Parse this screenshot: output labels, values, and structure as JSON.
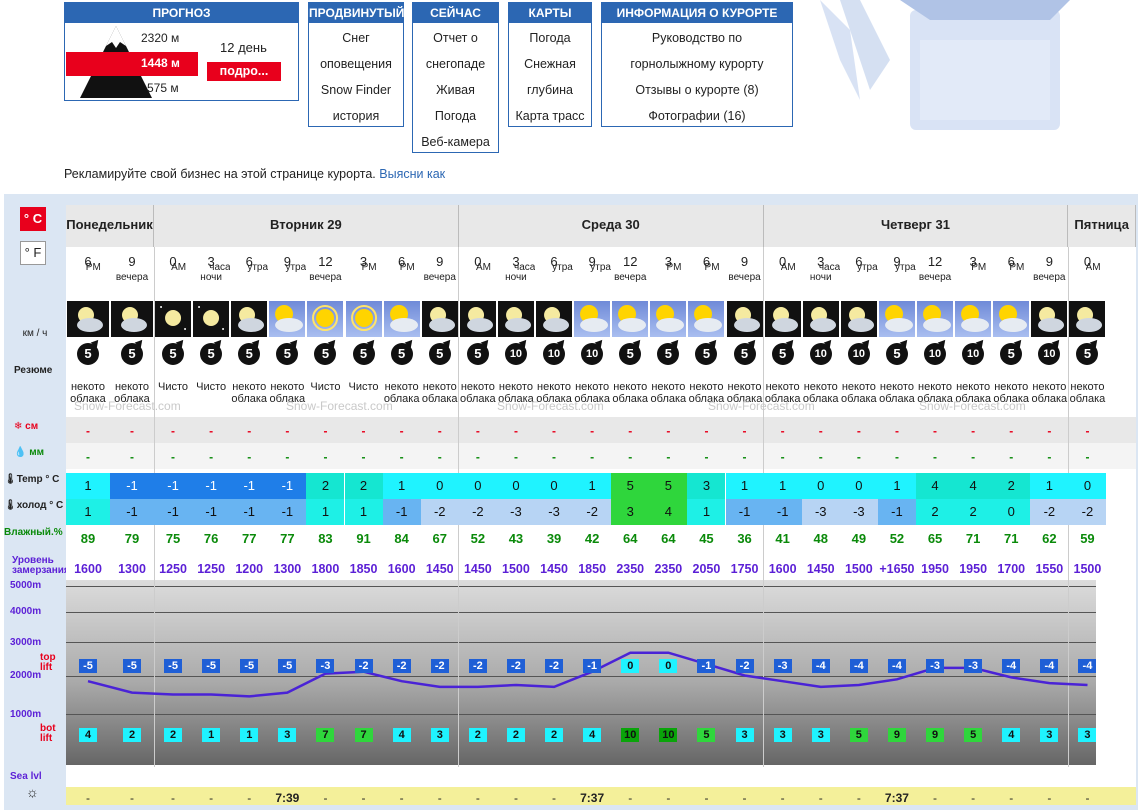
{
  "menus": [
    {
      "id": "forecast",
      "header": "ПРОГНОЗ",
      "items": []
    },
    {
      "id": "advanced",
      "header": "ПРОДВИНУТЫЙ",
      "items": [
        "Снег",
        "оповещения",
        "Snow Finder",
        "история"
      ]
    },
    {
      "id": "now",
      "header": "СЕЙЧАС",
      "items": [
        "Отчет о",
        "снегопаде",
        "Живая",
        "Погода",
        "Веб-камера"
      ]
    },
    {
      "id": "maps",
      "header": "КАРТЫ",
      "items": [
        "Погода",
        "Снежная",
        "глубина",
        "Карта трасс"
      ]
    },
    {
      "id": "info",
      "header": "ИНФОРМАЦИЯ О КУРОРТЕ",
      "items": [
        "Руководство по",
        "горнолыжному курорту",
        "Отзывы о курорте (8)",
        "Фотографии (16)"
      ]
    }
  ],
  "forecast_box": {
    "top_elev": "2320 м",
    "mid_elev": "1448 м",
    "bot_elev": "575 м",
    "days": "12 день",
    "more": "подро..."
  },
  "ad": {
    "text": "Рекламируйте свой бизнес на этой странице курорта.",
    "link": "Выясни как"
  },
  "units": {
    "celsius": "° C",
    "fahrenheit": "° F"
  },
  "labels": {
    "wind": "км / ч",
    "summary": "Резюме",
    "snow": "см",
    "rain": "мм",
    "temp": "Temp ° C",
    "chill": "холод ° C",
    "humidity": "Влажный.%",
    "freeze": "Уровень замерзания",
    "toplift": "top lift",
    "botlift": "bot lift",
    "sealvl": "Sea lvl"
  },
  "alt_labels": [
    "5000m",
    "4000m",
    "3000m",
    "2000m",
    "1000m"
  ],
  "watermark": "Snow-Forecast.com",
  "days": [
    {
      "name": "Понедельник",
      "cols": 2
    },
    {
      "name": "Вторник 29",
      "cols": 8
    },
    {
      "name": "Среда 30",
      "cols": 8
    },
    {
      "name": "Четверг 31",
      "cols": 8
    },
    {
      "name": "Пятница",
      "cols": 1
    }
  ],
  "periods": [
    {
      "time": "6",
      "sub": "PM",
      "sub2": ""
    },
    {
      "time": "9",
      "sub": "",
      "sub2": "вечера"
    },
    {
      "time": "0",
      "sub": "AM",
      "sub2": ""
    },
    {
      "time": "3",
      "sub": "часа",
      "sub2": "ночи"
    },
    {
      "time": "6",
      "sub": "утра",
      "sub2": ""
    },
    {
      "time": "9",
      "sub": "утра",
      "sub2": ""
    },
    {
      "time": "12",
      "sub": "",
      "sub2": "вечера"
    },
    {
      "time": "3",
      "sub": "PM",
      "sub2": ""
    },
    {
      "time": "6",
      "sub": "PM",
      "sub2": ""
    },
    {
      "time": "9",
      "sub": "",
      "sub2": "вечера"
    },
    {
      "time": "0",
      "sub": "AM",
      "sub2": ""
    },
    {
      "time": "3",
      "sub": "часа",
      "sub2": "ночи"
    },
    {
      "time": "6",
      "sub": "утра",
      "sub2": ""
    },
    {
      "time": "9",
      "sub": "утра",
      "sub2": ""
    },
    {
      "time": "12",
      "sub": "",
      "sub2": "вечера"
    },
    {
      "time": "3",
      "sub": "PM",
      "sub2": ""
    },
    {
      "time": "6",
      "sub": "PM",
      "sub2": ""
    },
    {
      "time": "9",
      "sub": "",
      "sub2": "вечера"
    },
    {
      "time": "0",
      "sub": "AM",
      "sub2": ""
    },
    {
      "time": "3",
      "sub": "часа",
      "sub2": "ночи"
    },
    {
      "time": "6",
      "sub": "утра",
      "sub2": ""
    },
    {
      "time": "9",
      "sub": "утра",
      "sub2": ""
    },
    {
      "time": "12",
      "sub": "",
      "sub2": "вечера"
    },
    {
      "time": "3",
      "sub": "PM",
      "sub2": ""
    },
    {
      "time": "6",
      "sub": "PM",
      "sub2": ""
    },
    {
      "time": "9",
      "sub": "",
      "sub2": "вечера"
    },
    {
      "time": "0",
      "sub": "AM",
      "sub2": ""
    }
  ],
  "icons": [
    "pc-night",
    "pc-night",
    "clear-night",
    "clear-night",
    "pc-night",
    "pc-day",
    "sun",
    "sun",
    "pc-day",
    "pc-night",
    "pc-night",
    "pc-night",
    "pc-night",
    "pc-day",
    "pc-day",
    "pc-day",
    "pc-day",
    "pc-night",
    "pc-night",
    "pc-night",
    "pc-night",
    "pc-day",
    "pc-day",
    "pc-day",
    "pc-day",
    "pc-night",
    "pc-night"
  ],
  "wind": [
    "5",
    "5",
    "5",
    "5",
    "5",
    "5",
    "5",
    "5",
    "5",
    "5",
    "5",
    "10",
    "10",
    "10",
    "5",
    "5",
    "5",
    "5",
    "5",
    "10",
    "10",
    "5",
    "10",
    "10",
    "5",
    "10",
    "5"
  ],
  "summary": [
    [
      "некото",
      "облака"
    ],
    [
      "некото",
      "облака"
    ],
    [
      "Чисто",
      ""
    ],
    [
      "Чисто",
      ""
    ],
    [
      "некото",
      "облака"
    ],
    [
      "некото",
      "облака"
    ],
    [
      "Чисто",
      ""
    ],
    [
      "Чисто",
      ""
    ],
    [
      "некото",
      "облака"
    ],
    [
      "некото",
      "облака"
    ],
    [
      "некото",
      "облака"
    ],
    [
      "некото",
      "облака"
    ],
    [
      "некото",
      "облака"
    ],
    [
      "некото",
      "облака"
    ],
    [
      "некото",
      "облака"
    ],
    [
      "некото",
      "облака"
    ],
    [
      "некото",
      "облака"
    ],
    [
      "некото",
      "облака"
    ],
    [
      "некото",
      "облака"
    ],
    [
      "некото",
      "облака"
    ],
    [
      "некото",
      "облака"
    ],
    [
      "некото",
      "облака"
    ],
    [
      "некото",
      "облака"
    ],
    [
      "некото",
      "облака"
    ],
    [
      "некото",
      "облака"
    ],
    [
      "некото",
      "облака"
    ],
    [
      "некото",
      "облака"
    ]
  ],
  "snow": [
    "-",
    "-",
    "-",
    "-",
    "-",
    "-",
    "-",
    "-",
    "-",
    "-",
    "-",
    "-",
    "-",
    "-",
    "-",
    "-",
    "-",
    "-",
    "-",
    "-",
    "-",
    "-",
    "-",
    "-",
    "-",
    "-",
    "-"
  ],
  "rain": [
    "-",
    "-",
    "-",
    "-",
    "-",
    "-",
    "-",
    "-",
    "-",
    "-",
    "-",
    "-",
    "-",
    "-",
    "-",
    "-",
    "-",
    "-",
    "-",
    "-",
    "-",
    "-",
    "-",
    "-",
    "-",
    "-",
    "-"
  ],
  "temp": [
    "1",
    "-1",
    "-1",
    "-1",
    "-1",
    "-1",
    "2",
    "2",
    "1",
    "0",
    "0",
    "0",
    "0",
    "1",
    "5",
    "5",
    "3",
    "1",
    "1",
    "0",
    "0",
    "1",
    "4",
    "4",
    "2",
    "1",
    "0"
  ],
  "chill": [
    "1",
    "-1",
    "-1",
    "-1",
    "-1",
    "-1",
    "1",
    "1",
    "-1",
    "-2",
    "-2",
    "-3",
    "-3",
    "-2",
    "3",
    "4",
    "1",
    "-1",
    "-1",
    "-3",
    "-3",
    "-1",
    "2",
    "2",
    "0",
    "-2",
    "-2"
  ],
  "humidity": [
    "89",
    "79",
    "75",
    "76",
    "77",
    "77",
    "83",
    "91",
    "84",
    "67",
    "52",
    "43",
    "39",
    "42",
    "64",
    "64",
    "45",
    "36",
    "41",
    "48",
    "49",
    "52",
    "65",
    "71",
    "71",
    "62",
    "59"
  ],
  "freeze": [
    "1600",
    "1300",
    "1250",
    "1250",
    "1200",
    "1300",
    "1800",
    "1850",
    "1600",
    "1450",
    "1450",
    "1500",
    "1450",
    "1850",
    "2350",
    "2350",
    "2050",
    "1750",
    "1600",
    "1450",
    "1500",
    "+1650",
    "1950",
    "1950",
    "1700",
    "1550",
    "1500"
  ],
  "toplift": [
    "-5",
    "-5",
    "-5",
    "-5",
    "-5",
    "-5",
    "-3",
    "-2",
    "-2",
    "-2",
    "-2",
    "-2",
    "-2",
    "-1",
    "0",
    "0",
    "-1",
    "-2",
    "-3",
    "-4",
    "-4",
    "-4",
    "-3",
    "-3",
    "-4",
    "-4",
    "-4"
  ],
  "botlift": [
    "4",
    "2",
    "2",
    "1",
    "1",
    "3",
    "7",
    "7",
    "4",
    "3",
    "2",
    "2",
    "2",
    "4",
    "10",
    "10",
    "5",
    "3",
    "3",
    "3",
    "5",
    "9",
    "9",
    "5",
    "4",
    "3",
    "3"
  ],
  "sun": [
    "-",
    "-",
    "-",
    "-",
    "-",
    "7:39",
    "-",
    "-",
    "-",
    "-",
    "-",
    "-",
    "-",
    "7:37",
    "-",
    "-",
    "-",
    "-",
    "-",
    "-",
    "-",
    "7:37",
    "-",
    "-",
    "-",
    "-",
    "-"
  ],
  "colors": {
    "blue": "#2c67b3",
    "red": "#e8001c",
    "purple": "#5b1fd6",
    "green": "#0a8a0a"
  }
}
